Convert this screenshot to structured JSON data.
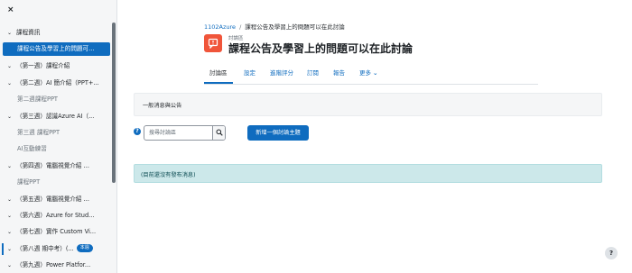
{
  "sidebar": {
    "close_icon": "×",
    "items": [
      {
        "chev": "⌄",
        "label": "課程資訊"
      },
      {
        "label": "課程公告及學習上的問題可..."
      },
      {
        "chev": "⌄",
        "label": "（第一週）課程介紹"
      },
      {
        "chev": "⌄",
        "label": "（第二週）AI 簡介紹（PPT+..."
      },
      {
        "label": "第二週課程PPT"
      },
      {
        "chev": "⌄",
        "label": "（第三週）認識Azure AI（..."
      },
      {
        "label": "第三週 課程PPT"
      },
      {
        "label": "AI互動練習"
      },
      {
        "chev": "⌄",
        "label": "（第四週）電腦視覺介紹 ..."
      },
      {
        "label": "課程PPT"
      },
      {
        "chev": "⌄",
        "label": "（第五週）電腦視覺介紹 ..."
      },
      {
        "chev": "⌄",
        "label": "（第六週）Azure for Stud..."
      },
      {
        "chev": "⌄",
        "label": "（第七週）實作 Custom Vi..."
      },
      {
        "chev": "⌄",
        "label": "（第八週 期中考）(...",
        "badge": "本週"
      },
      {
        "chev": "⌄",
        "label": "（第九週）Power Platfor..."
      }
    ]
  },
  "breadcrumb": {
    "course": "1102Azure",
    "sep": "/",
    "current": "課程公告及學習上的問題可以在此討論"
  },
  "header": {
    "pre_title": "討論區",
    "title": "課程公告及學習上的問題可以在此討論"
  },
  "tabs": [
    {
      "label": "討論區"
    },
    {
      "label": "設定"
    },
    {
      "label": "進階評分"
    },
    {
      "label": "訂閱"
    },
    {
      "label": "報告"
    },
    {
      "label": "更多"
    }
  ],
  "more_chevron": "⌄",
  "panel_text": "一般消息與公告",
  "search": {
    "placeholder": "搜尋討論區"
  },
  "add_button": "新增一個討論主題",
  "alert_text": "(目前還沒有發布消息)",
  "help_fab": "?",
  "help_icon": "?",
  "colors": {
    "primary": "#0f6cbf",
    "forum_icon": "#f0553a",
    "alert_bg": "#cce8ea"
  }
}
